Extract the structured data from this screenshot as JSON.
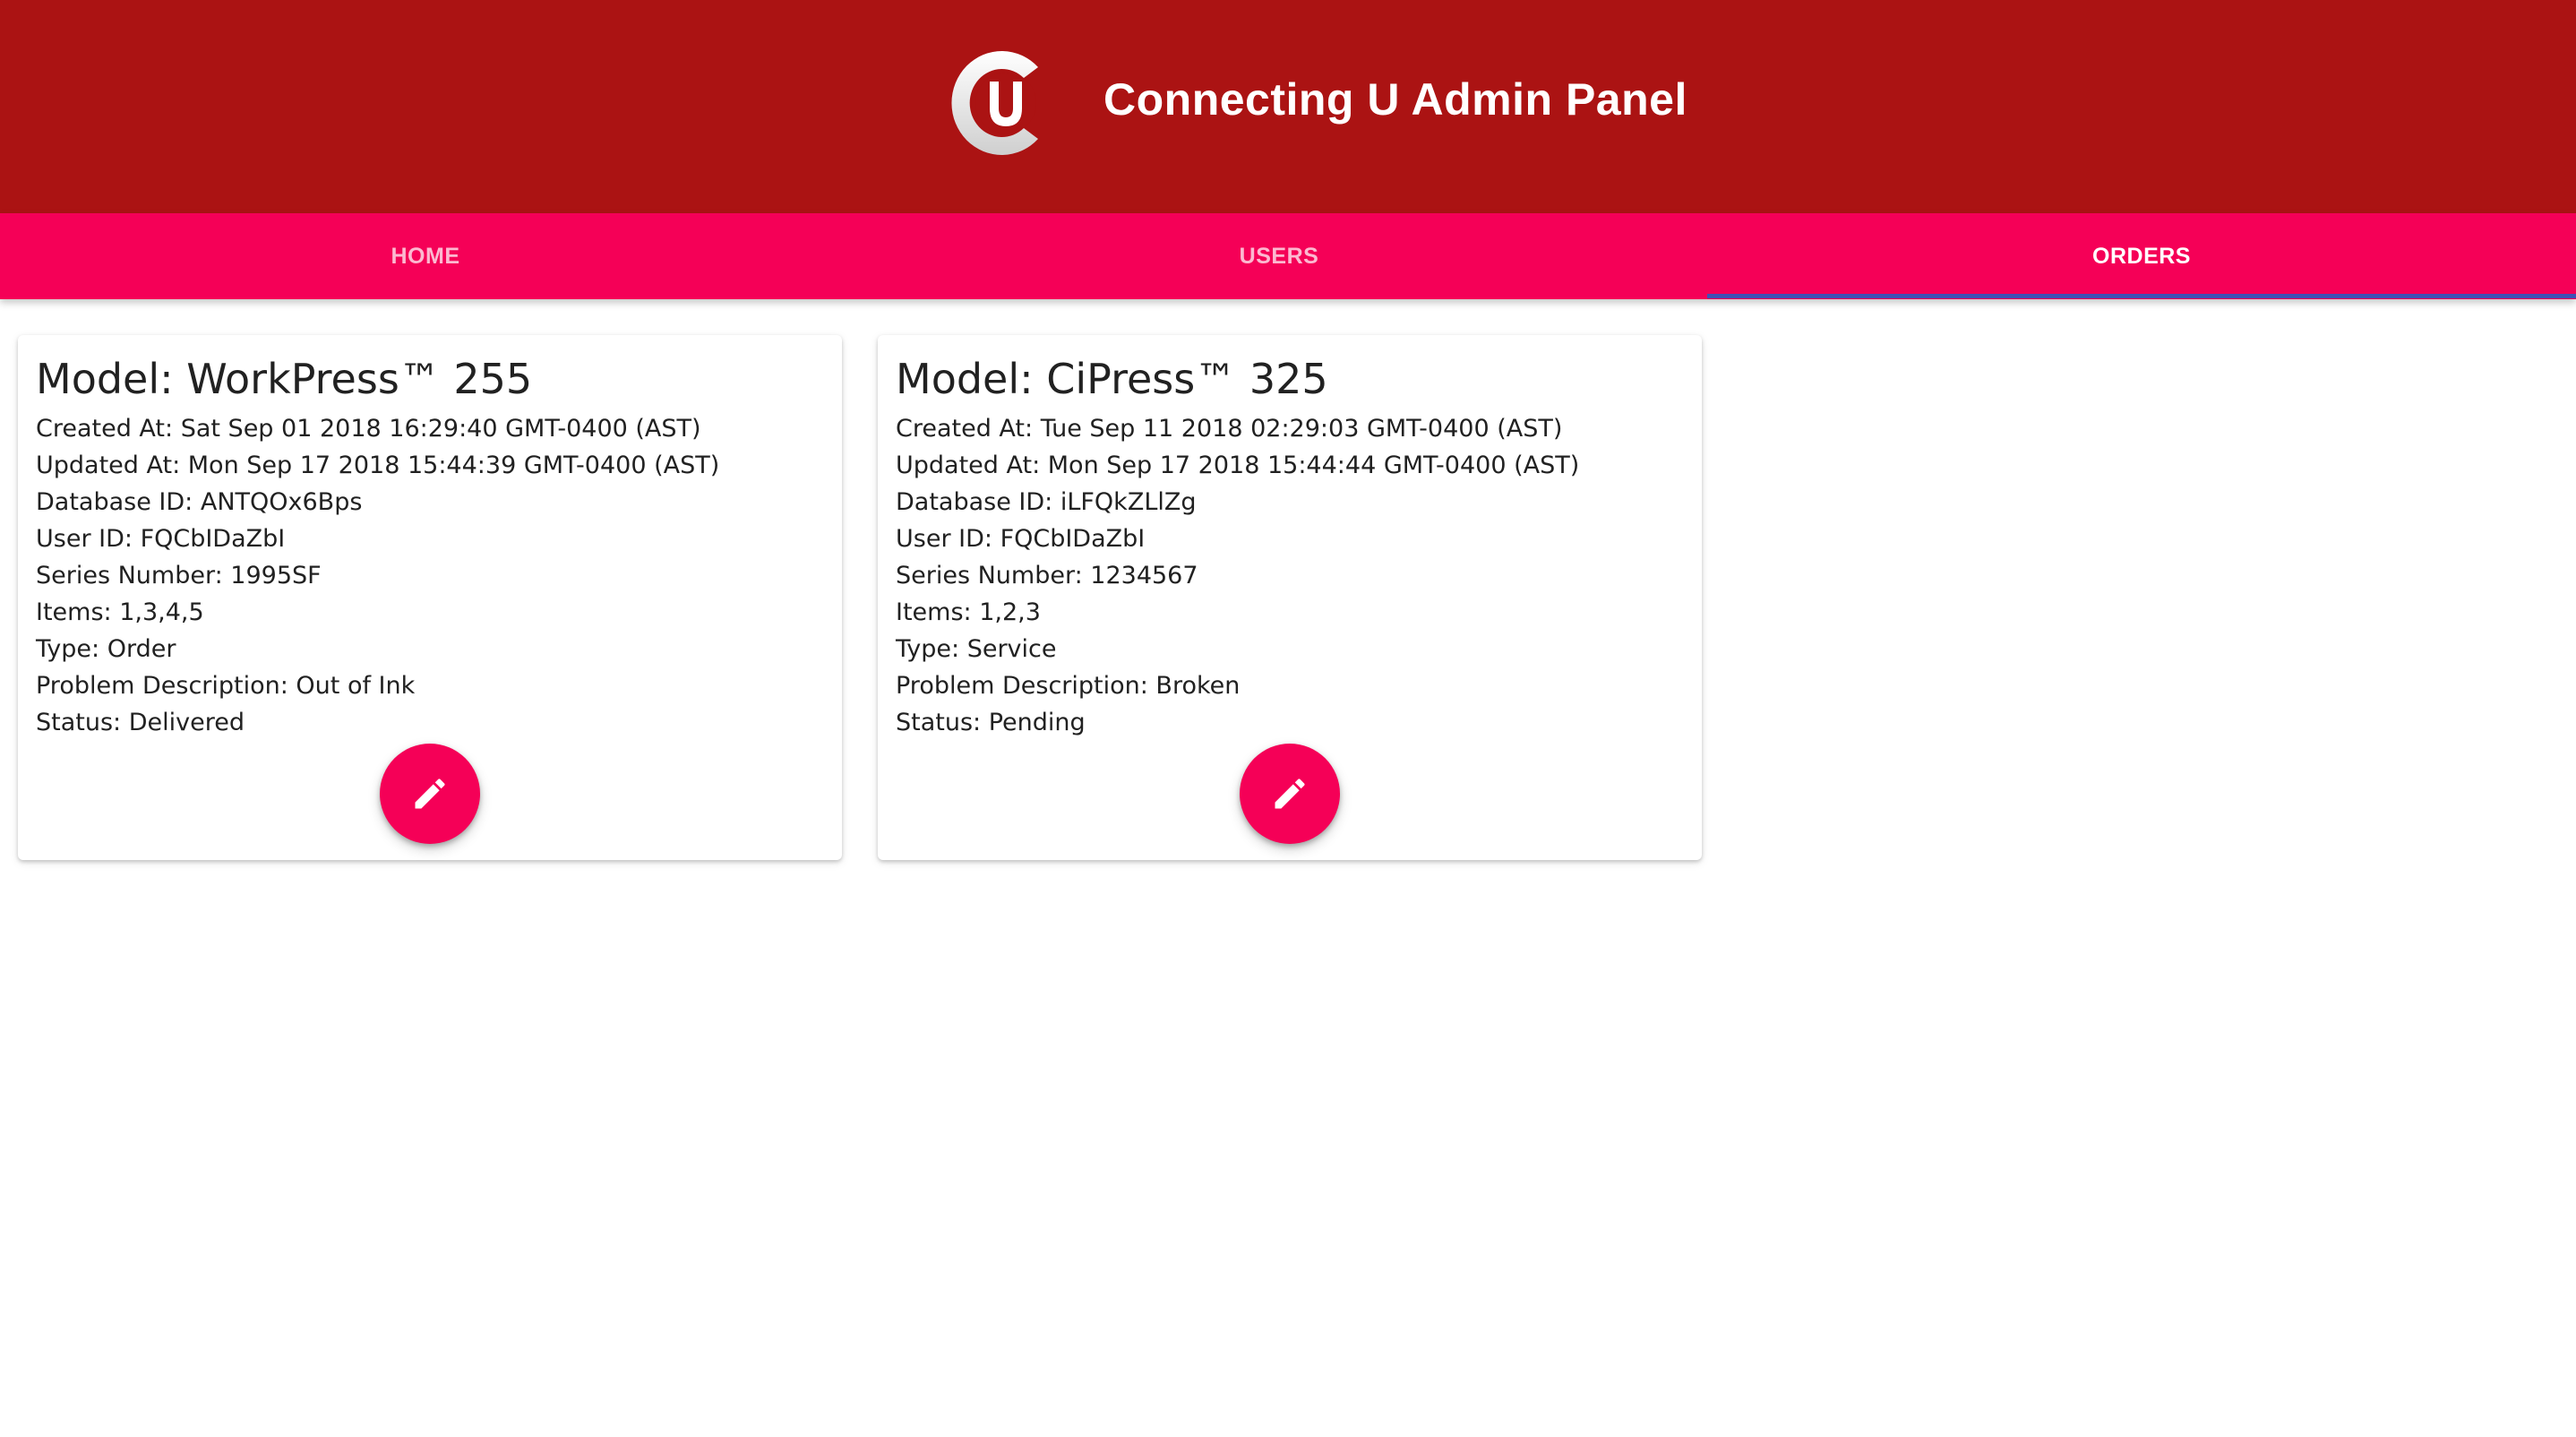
{
  "header": {
    "title": "Connecting U Admin Panel",
    "logo_letters": "CU",
    "background": "#ab1313"
  },
  "tabs": [
    {
      "label": "HOME",
      "active": false
    },
    {
      "label": "USERS",
      "active": false
    },
    {
      "label": "ORDERS",
      "active": true
    }
  ],
  "colors": {
    "tab_bar": "#f50057",
    "indicator": "#3f51b5",
    "fab": "#f50057"
  },
  "orders": [
    {
      "title": "Model: WorkPress™ 255",
      "fields": [
        {
          "label": "Created At: ",
          "value": "Sat Sep 01 2018 16:29:40 GMT-0400 (AST)"
        },
        {
          "label": "Updated At: ",
          "value": "Mon Sep 17 2018 15:44:39 GMT-0400 (AST)"
        },
        {
          "label": "Database ID: ",
          "value": "ANTQOx6Bps"
        },
        {
          "label": "User ID: ",
          "value": "FQCbIDaZbI"
        },
        {
          "label": "Series Number: ",
          "value": "1995SF"
        },
        {
          "label": "Items: ",
          "value": "1,3,4,5"
        },
        {
          "label": "Type: ",
          "value": "Order"
        },
        {
          "label": "Problem Description: ",
          "value": "Out of Ink"
        },
        {
          "label": "Status: ",
          "value": "Delivered"
        }
      ],
      "edit_icon": "pencil-icon"
    },
    {
      "title": "Model: CiPress™ 325",
      "fields": [
        {
          "label": "Created At: ",
          "value": "Tue Sep 11 2018 02:29:03 GMT-0400 (AST)"
        },
        {
          "label": "Updated At: ",
          "value": "Mon Sep 17 2018 15:44:44 GMT-0400 (AST)"
        },
        {
          "label": "Database ID: ",
          "value": "iLFQkZLlZg"
        },
        {
          "label": "User ID: ",
          "value": "FQCbIDaZbI"
        },
        {
          "label": "Series Number: ",
          "value": "1234567"
        },
        {
          "label": "Items: ",
          "value": "1,2,3"
        },
        {
          "label": "Type: ",
          "value": "Service"
        },
        {
          "label": "Problem Description: ",
          "value": "Broken"
        },
        {
          "label": "Status: ",
          "value": "Pending"
        }
      ],
      "edit_icon": "pencil-icon"
    }
  ]
}
